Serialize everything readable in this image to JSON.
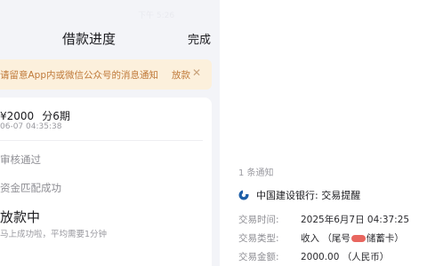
{
  "left_panel": {
    "status_bar": "下午 5:26",
    "nav": {
      "title": "借款进度",
      "done_label": "完成"
    },
    "notice": {
      "text": "请留意App内或微信公众号的消息通知",
      "link": "放款",
      "close_icon": "close-icon"
    },
    "loan": {
      "amount": "¥2000",
      "periods": "分6期",
      "time": "06-07 04:35:38",
      "steps": [
        {
          "label": "审核通过"
        },
        {
          "label": "资金匹配成功"
        },
        {
          "label": "放款中",
          "desc": "马上成功啦，平均需要1分钟"
        }
      ]
    }
  },
  "right_panel": {
    "notification_count": "1 条通知",
    "bank_icon": "ccb-logo-icon",
    "title": "中国建设银行: 交易提醒",
    "fields": [
      {
        "label": "交易时间:",
        "value": "2025年6月7日 04:37:25"
      },
      {
        "label": "交易类型:",
        "value_prefix": "收入 （尾号",
        "value_suffix": "储蓄卡）"
      },
      {
        "label": "交易金额:",
        "value": "2000.00 （人民币）"
      }
    ]
  }
}
